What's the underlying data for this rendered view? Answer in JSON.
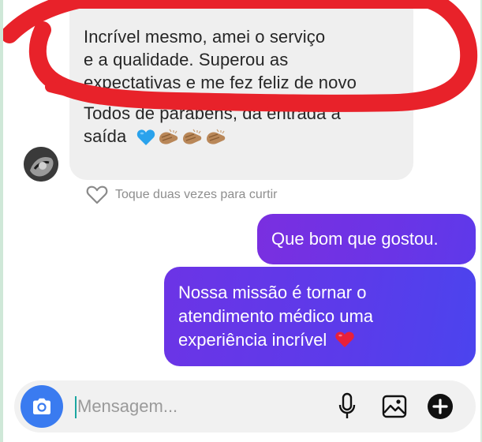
{
  "incoming": {
    "lines": [
      "Incrível mesmo, amei o serviço",
      "e a qualidade. Superou as",
      "expectativas e me fez feliz de novo",
      "Todos de parabéns, da entrada à",
      "saída"
    ],
    "emojis": [
      "blue-heart",
      "clapping-hands",
      "clapping-hands",
      "clapping-hands"
    ],
    "like_hint": "Toque duas vezes para curtir"
  },
  "outgoing": [
    {
      "lines": [
        "Que bom que gostou."
      ]
    },
    {
      "lines": [
        "Nossa missão é tornar o",
        "atendimento médico uma",
        "experiência incrível"
      ],
      "emoji": "red-heart"
    }
  ],
  "composer": {
    "placeholder": "Mensagem...",
    "icons": [
      "camera-icon",
      "microphone-icon",
      "gallery-icon",
      "plus-icon"
    ]
  },
  "colors": {
    "incoming_bubble": "#efefef",
    "outgoing_bubble": "#6b34e6",
    "annotation_ring": "#e8222a",
    "camera_button": "#3a7bf0"
  }
}
